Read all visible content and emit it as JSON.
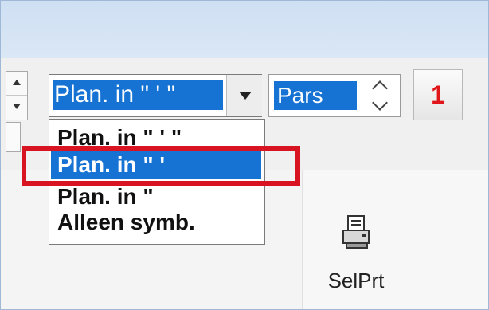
{
  "units_combo": {
    "selected": "Plan. in \" ' \"",
    "options": [
      "Plan. in \" ' \"",
      "Plan. in \" '",
      "Plan. in \"",
      "Alleen symb."
    ]
  },
  "mode_field": {
    "value": "Pars"
  },
  "number_button": {
    "label": "1"
  },
  "selprt": {
    "label": "SelPrt",
    "icon": "printer-icon"
  }
}
